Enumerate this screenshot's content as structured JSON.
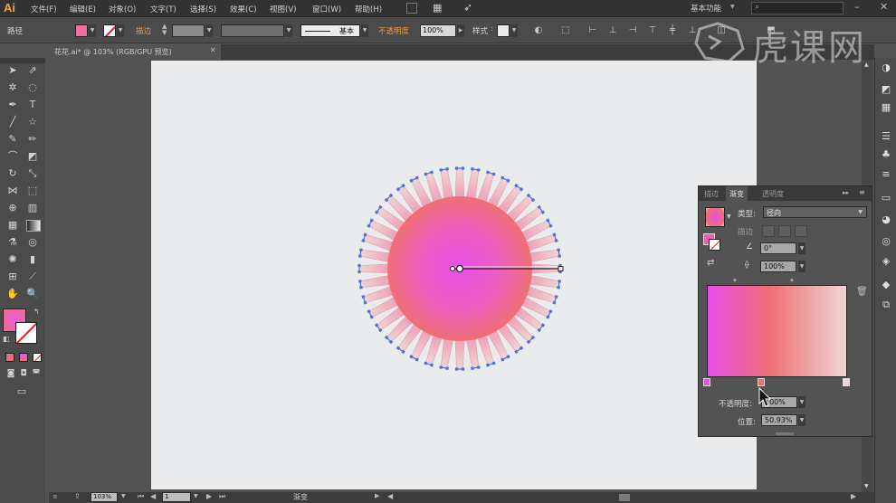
{
  "app": {
    "logo": "Ai"
  },
  "menu": [
    "文件(F)",
    "编辑(E)",
    "对象(O)",
    "文字(T)",
    "选择(S)",
    "效果(C)",
    "视图(V)",
    "窗口(W)",
    "帮助(H)"
  ],
  "workspace": {
    "label": "基本功能",
    "search_placeholder": ""
  },
  "control_bar": {
    "selection_label": "路径",
    "stroke_label": "描边",
    "stroke_style": "基本",
    "opacity_label": "不透明度",
    "opacity_value": "100%",
    "style_label": "样式"
  },
  "document": {
    "tab_title": "花花.ai* @ 103% (RGB/GPU 预览)"
  },
  "gradient_panel": {
    "tabs": [
      "描边",
      "渐变",
      "透明度"
    ],
    "active_tab": "渐变",
    "type_label": "类型:",
    "type_value": "径向",
    "stroke_label": "描边",
    "angle_value": "0°",
    "aspect_value": "100%",
    "opacity_label": "不透明度:",
    "opacity_value": "100%",
    "position_label": "位置:",
    "position_value": "50.93%",
    "stops": [
      {
        "color": "#e84ee8",
        "position": 0
      },
      {
        "color": "#ef6f73",
        "position": 0.4
      },
      {
        "color": "#eed6d4",
        "position": 1
      }
    ]
  },
  "status": {
    "zoom": "103%",
    "page": "1",
    "tool_name": "渐变"
  },
  "colors": {
    "fill_center": "#e84ee8",
    "fill_edge": "#ef6f73",
    "petal_light": "#eed6d4",
    "anchor": "#4f6fd6"
  },
  "watermark": "虎课网"
}
